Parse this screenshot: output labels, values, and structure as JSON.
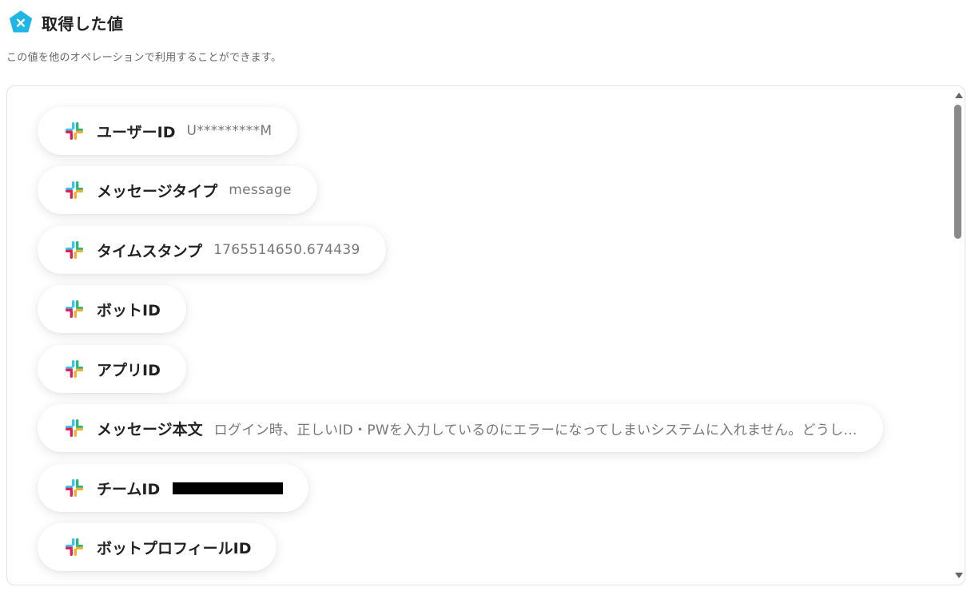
{
  "header": {
    "icon": "yoom-pentagon-x-icon",
    "title": "取得した値",
    "description": "この値を他のオペレーションで利用することができます。"
  },
  "colors": {
    "accent": "#1fb6e6",
    "slack_blue": "#36C5F0",
    "slack_green": "#2EB67D",
    "slack_yellow": "#ECB22E",
    "slack_red": "#E01E5A"
  },
  "fields": [
    {
      "icon": "slack-icon",
      "label": "ユーザーID",
      "value": "U*********M"
    },
    {
      "icon": "slack-icon",
      "label": "メッセージタイプ",
      "value": "message"
    },
    {
      "icon": "slack-icon",
      "label": "タイムスタンプ",
      "value": "1765514650.674439"
    },
    {
      "icon": "slack-icon",
      "label": "ボットID",
      "value": ""
    },
    {
      "icon": "slack-icon",
      "label": "アプリID",
      "value": ""
    },
    {
      "icon": "slack-icon",
      "label": "メッセージ本文",
      "value": "ログイン時、正しいID・PWを入力しているのにエラーになってしまいシステムに入れません。どうし..."
    },
    {
      "icon": "slack-icon",
      "label": "チームID",
      "value": "",
      "redacted": true
    },
    {
      "icon": "slack-icon",
      "label": "ボットプロフィールID",
      "value": ""
    }
  ]
}
